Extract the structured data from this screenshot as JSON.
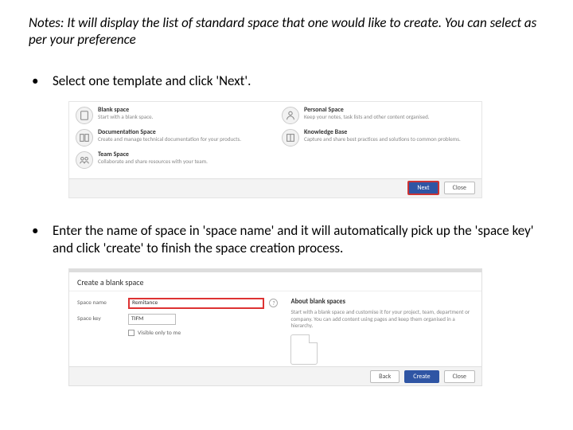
{
  "notes": "Notes: It will display the list of standard space that one would like to create. You can select as per your preference",
  "step1": "Select one template and click 'Next'.",
  "step2": "Enter the name of space in 'space name' and it will automatically pick up the 'space key' and click 'create' to finish the space creation process.",
  "templates": {
    "left": [
      {
        "title": "Blank space",
        "desc": "Start with a blank space."
      },
      {
        "title": "Documentation Space",
        "desc": "Create and manage technical documentation for your products."
      },
      {
        "title": "Team Space",
        "desc": "Collaborate and share resources with your team."
      }
    ],
    "right": [
      {
        "title": "Personal Space",
        "desc": "Keep your notes, task lists and other content organised."
      },
      {
        "title": "Knowledge Base",
        "desc": "Capture and share best practices and solutions to common problems."
      }
    ],
    "buttons": {
      "next": "Next",
      "close": "Close"
    }
  },
  "dialog": {
    "title": "Create a blank space",
    "labels": {
      "name": "Space name",
      "key": "Space key",
      "visible": "Visible only to me"
    },
    "values": {
      "name": "Remitance",
      "key": "TIFM"
    },
    "about": {
      "title": "About blank spaces",
      "text": "Start with a blank space and customise it for your project, team, department or company. You can add content using pages and keep them organised in a hierarchy."
    },
    "buttons": {
      "back": "Back",
      "create": "Create",
      "close": "Close"
    }
  }
}
